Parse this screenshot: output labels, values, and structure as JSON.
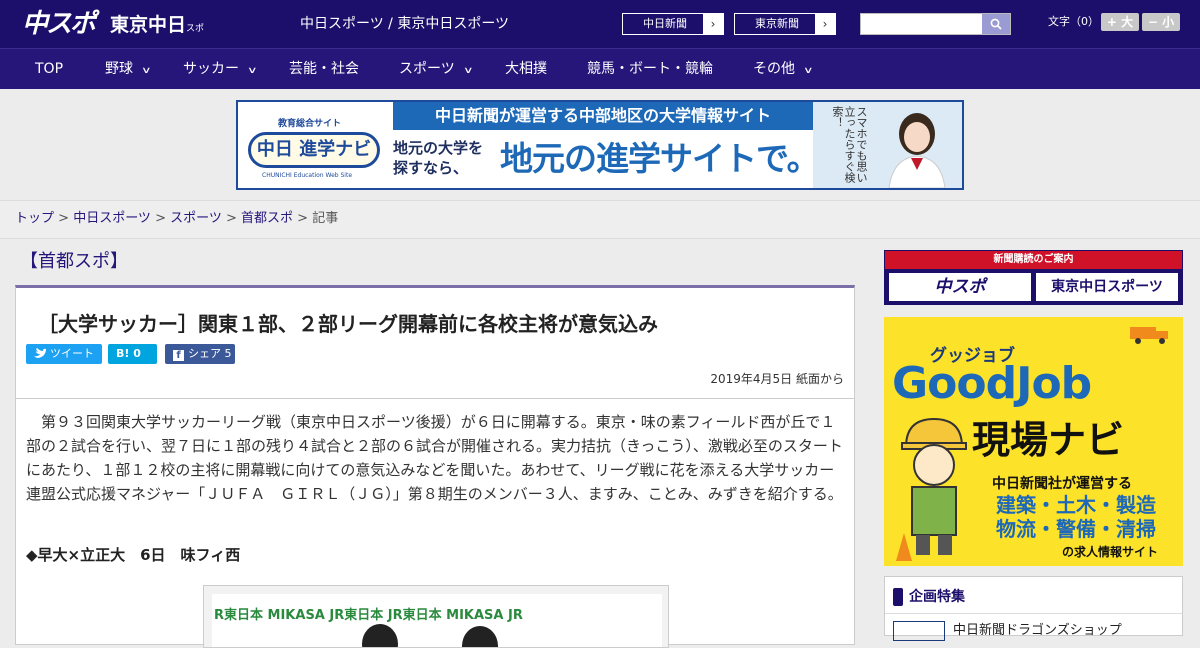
{
  "header": {
    "logo_chuspo": "中スポ",
    "logo_tokyo": "東京中日",
    "logo_tokyo_small": "スポーツ",
    "site_names": "中日スポーツ / 東京中日スポーツ",
    "btn_chunichi": "中日新聞",
    "btn_tokyo": "東京新聞",
    "arrow": "›",
    "search_placeholder": "",
    "font_label": "文字（0）",
    "font_plus": "+ 大",
    "font_minus": "− 小"
  },
  "nav": {
    "items": [
      {
        "label": "TOP",
        "dropdown": false
      },
      {
        "label": "野球",
        "dropdown": true
      },
      {
        "label": "サッカー",
        "dropdown": true
      },
      {
        "label": "芸能・社会",
        "dropdown": false
      },
      {
        "label": "スポーツ",
        "dropdown": true
      },
      {
        "label": "大相撲",
        "dropdown": false
      },
      {
        "label": "競馬・ボート・競輪",
        "dropdown": false
      },
      {
        "label": "その他",
        "dropdown": true
      }
    ],
    "chevron": "∨"
  },
  "banner": {
    "edu_site": "教育総合サイト",
    "navi": "中日 進学ナビ",
    "cedu": "CHUNICHI Education Web Site",
    "top_text": "中日新聞が運営する中部地区の大学情報サイト",
    "sub_text": "地元の大学を探すなら、",
    "main_text": "地元の進学サイトで。",
    "vertical_text": "スマホでも思い立ったらすぐ検索！"
  },
  "breadcrumb": {
    "items": [
      "トップ",
      "中日スポーツ",
      "スポーツ",
      "首都スポ"
    ],
    "current": "記事",
    "sep": " > "
  },
  "section_title": "【首都スポ】",
  "article": {
    "headline": "［大学サッカー］関東１部、２部リーグ開幕前に各校主将が意気込み",
    "tweet": "ツイート",
    "hatena": "B! 0",
    "share": "シェア 5",
    "date": "2019年4月5日 紙面から",
    "body": "第９３回関東大学サッカーリーグ戦（東京中日スポーツ後援）が６日に開幕する。東京・味の素フィールド西が丘で１部の２試合を行い、翌７日に１部の残り４試合と２部の６試合が開催される。実力拮抗（きっこう）、激戦必至のスタートにあたり、１部１２校の主将に開幕戦に向けての意気込みなどを聞いた。あわせて、リーグ戦に花を添える大学サッカー連盟公式応援マネジャー「ＪＵＦＡ　ＧＩＲＬ（ＪＧ）」第８期生のメンバー３人、ますみ、ことみ、みずきを紹介する。",
    "subhead": "◆早大×立正大　6日　味フィ西",
    "photo_text": "R東日本 MIKASA JR東日本 JR東日本 MIKASA JR"
  },
  "sidebar": {
    "ad1_top": "新聞購読のご案内",
    "ad1_left": "中スポ",
    "ad1_right": "東京中日スポーツ",
    "ad2_guj": "グッジョブ",
    "ad2_good": "GoodJob",
    "ad2_gen": "現場ナビ",
    "ad2_c1": "中日新聞社が運営する",
    "ad2_c2": "建築・土木・製造",
    "ad2_c3": "物流・警備・清掃",
    "ad2_c4": "の求人情報サイト",
    "box_title": "企画特集",
    "box_item": "中日新聞ドラゴンズショップ"
  },
  "colors": {
    "header_bg": "#1b0f6b",
    "nav_bg": "#26167a",
    "twitter": "#1da1f2",
    "hatena": "#00a4de",
    "facebook": "#3b5998",
    "accent_red": "#d01228"
  }
}
